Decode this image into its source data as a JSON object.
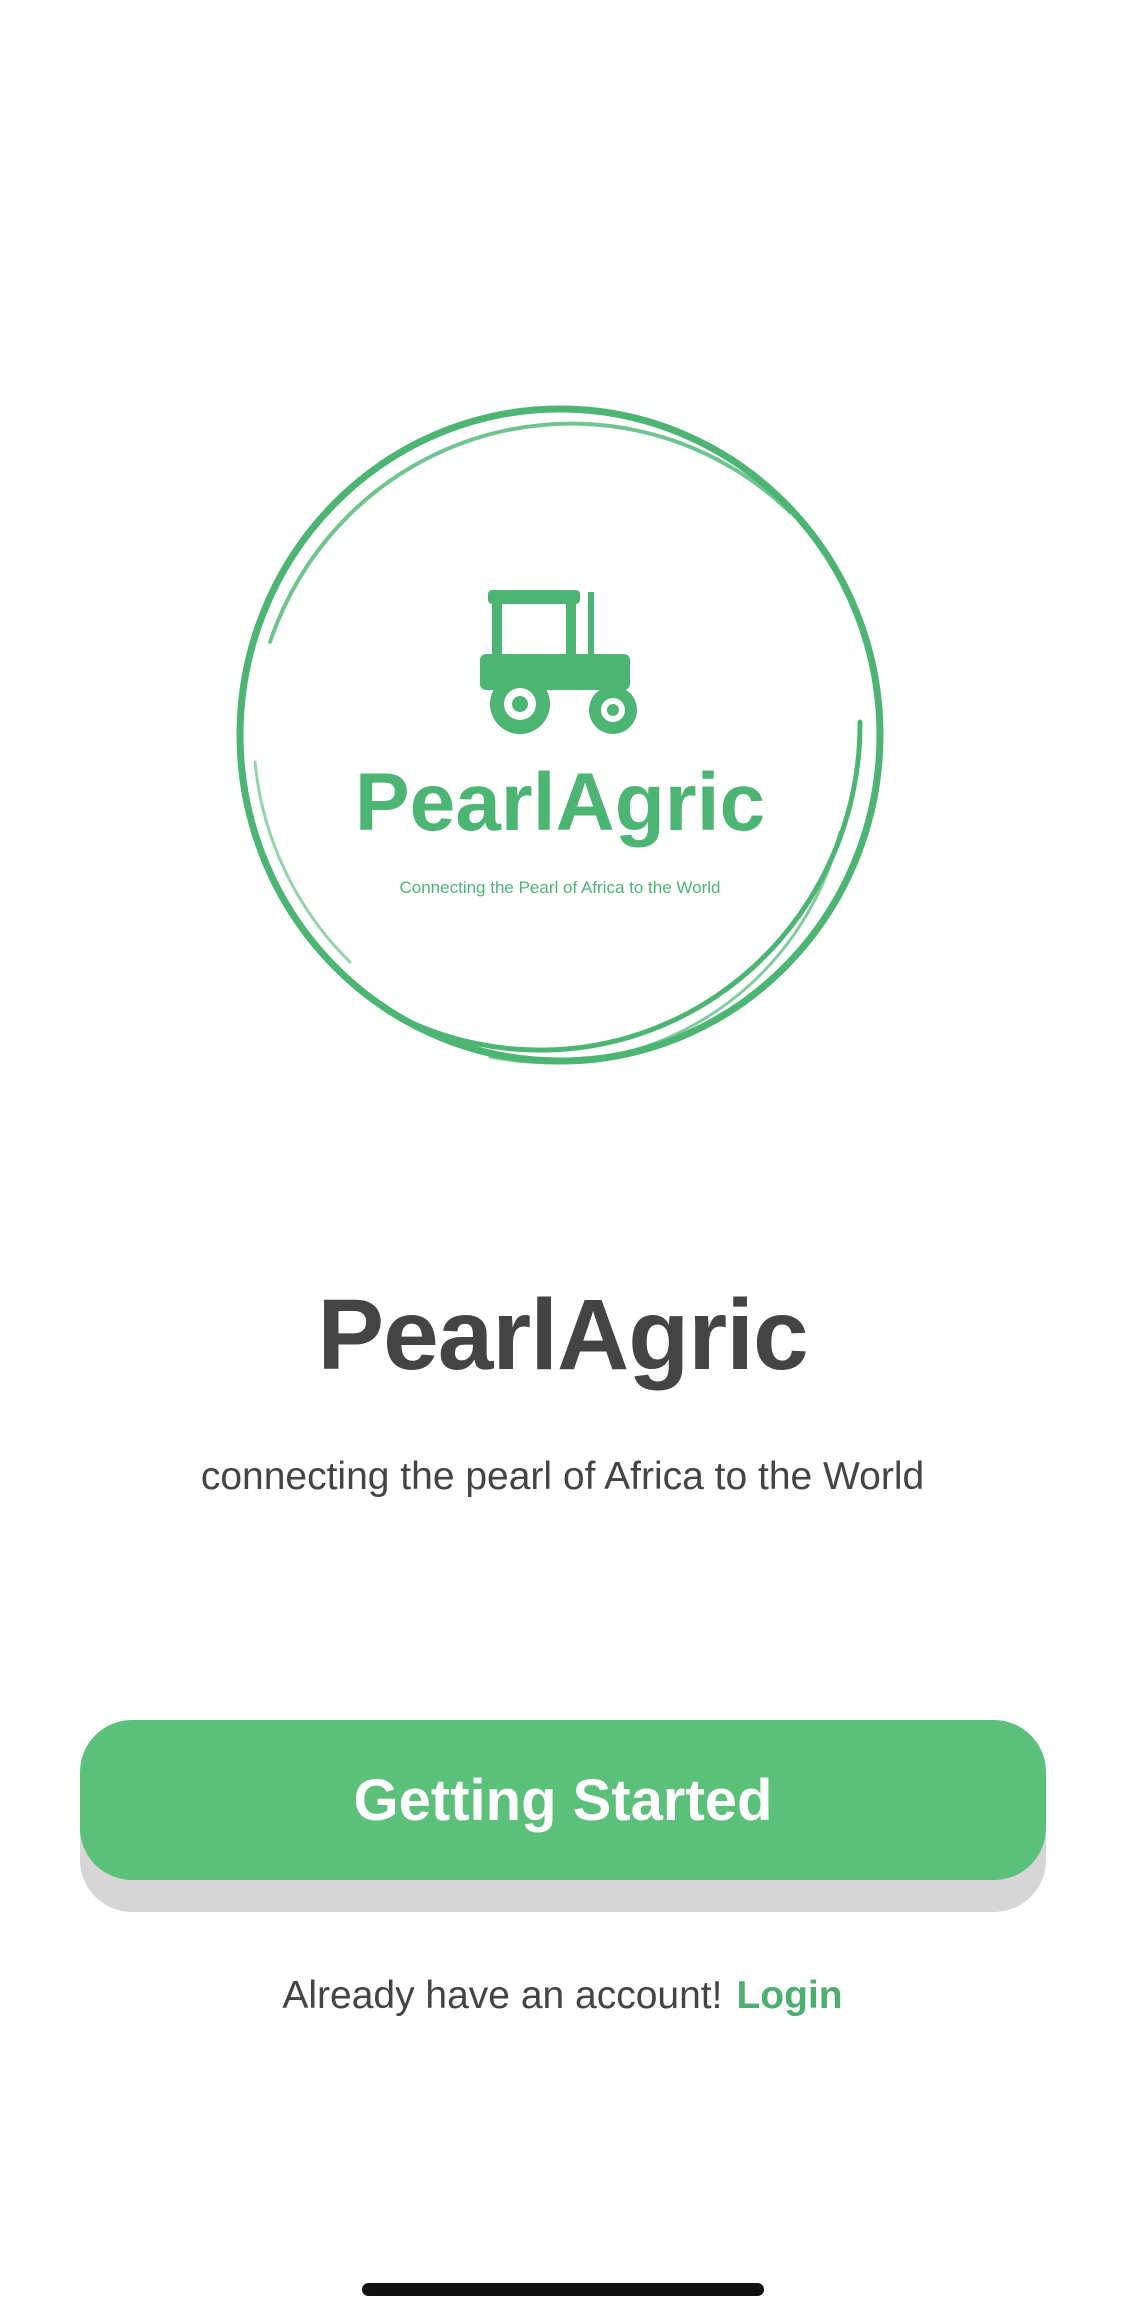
{
  "logo": {
    "icon": "tractor-icon",
    "name": "PearlAgric",
    "tagline": "Connecting the Pearl of Africa to the World",
    "color": "#4cb573"
  },
  "title": "PearlAgric",
  "tagline": "connecting the pearl of Africa to the World",
  "buttons": {
    "getting_started": "Getting Started"
  },
  "login": {
    "prompt": "Already have an account!",
    "link": "Login"
  },
  "colors": {
    "accent": "#5bc17a",
    "link": "#4caf6e",
    "text": "#444444"
  }
}
